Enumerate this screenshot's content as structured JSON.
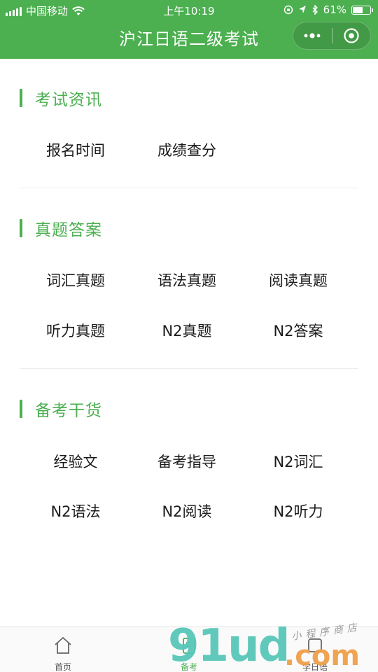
{
  "status_bar": {
    "carrier": "中国移动",
    "time": "上午10:19",
    "battery_text": "61%",
    "battery_level": 0.61
  },
  "nav": {
    "title": "沪江日语二级考试"
  },
  "sections": [
    {
      "title": "考试资讯",
      "items": [
        "报名时间",
        "成绩查分"
      ]
    },
    {
      "title": "真题答案",
      "items": [
        "词汇真题",
        "语法真题",
        "阅读真题",
        "听力真题",
        "N2真题",
        "N2答案"
      ]
    },
    {
      "title": "备考干货",
      "items": [
        "经验文",
        "备考指导",
        "N2词汇",
        "N2语法",
        "N2阅读",
        "N2听力"
      ]
    }
  ],
  "tabbar": {
    "tabs": [
      {
        "label": "首页",
        "icon": "home-icon"
      },
      {
        "label": "备考",
        "icon": "book-icon"
      },
      {
        "label": "学日语",
        "icon": "study-icon"
      }
    ]
  },
  "watermark": {
    "logo": "91ud",
    "suffix": ".com",
    "sub": "小程序商店"
  },
  "colors": {
    "accent": "#4caf50",
    "watermark_teal": "#58c7b9",
    "watermark_orange": "#f0a04a"
  }
}
